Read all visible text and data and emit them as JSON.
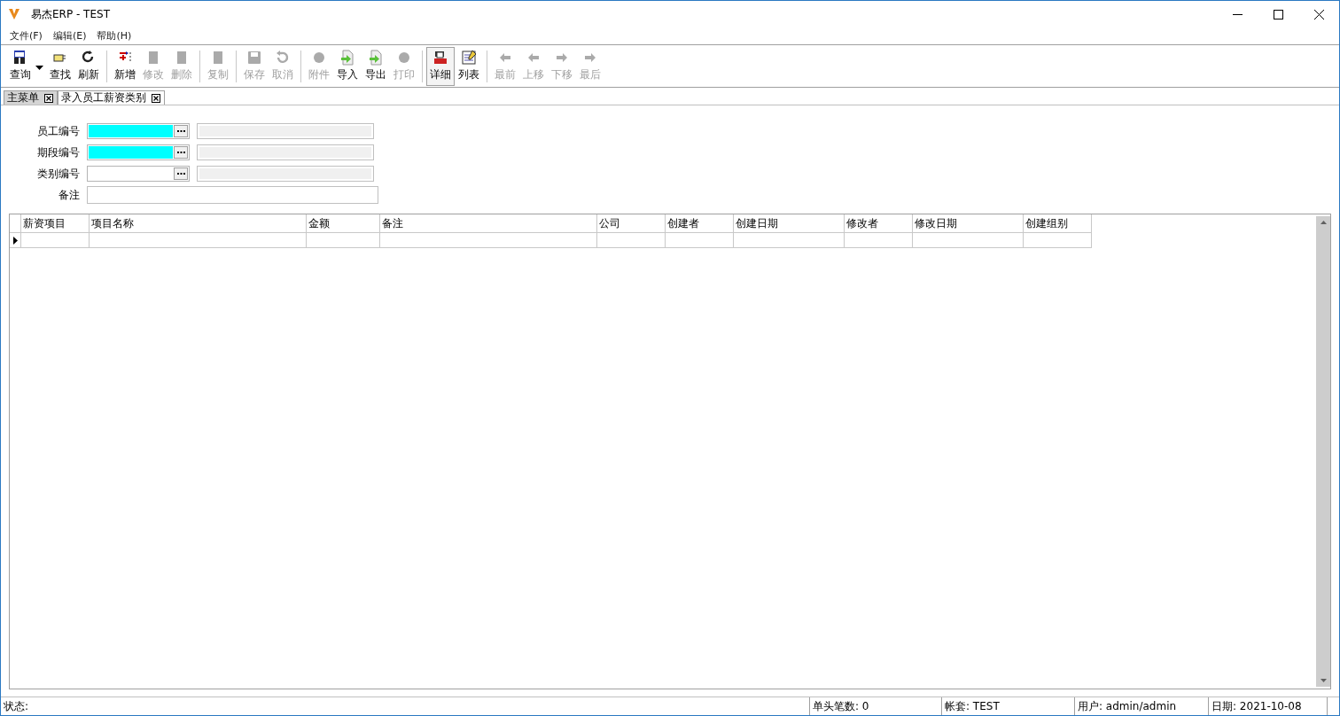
{
  "window": {
    "title": "易杰ERP - TEST"
  },
  "menu": [
    {
      "label": "文件(F)"
    },
    {
      "label": "编辑(E)"
    },
    {
      "label": "帮助(H)"
    }
  ],
  "toolbar": [
    {
      "items": [
        {
          "label": "查询",
          "disabled": false,
          "selected": false,
          "dropdown": true
        },
        {
          "label": "查找",
          "disabled": false,
          "selected": false,
          "dropdown": false
        },
        {
          "label": "刷新",
          "disabled": false,
          "selected": false,
          "dropdown": false
        }
      ]
    },
    {
      "items": [
        {
          "label": "新增",
          "disabled": false,
          "selected": false,
          "dropdown": false
        },
        {
          "label": "修改",
          "disabled": true,
          "selected": false,
          "dropdown": false
        },
        {
          "label": "删除",
          "disabled": true,
          "selected": false,
          "dropdown": false
        }
      ]
    },
    {
      "items": [
        {
          "label": "复制",
          "disabled": true,
          "selected": false,
          "dropdown": false
        }
      ]
    },
    {
      "items": [
        {
          "label": "保存",
          "disabled": true,
          "selected": false,
          "dropdown": false
        },
        {
          "label": "取消",
          "disabled": true,
          "selected": false,
          "dropdown": false
        }
      ]
    },
    {
      "items": [
        {
          "label": "附件",
          "disabled": true,
          "selected": false,
          "dropdown": false
        },
        {
          "label": "导入",
          "disabled": false,
          "selected": false,
          "dropdown": false
        },
        {
          "label": "导出",
          "disabled": false,
          "selected": false,
          "dropdown": false
        },
        {
          "label": "打印",
          "disabled": true,
          "selected": false,
          "dropdown": false
        }
      ]
    },
    {
      "items": [
        {
          "label": "详细",
          "disabled": false,
          "selected": true,
          "dropdown": false
        },
        {
          "label": "列表",
          "disabled": false,
          "selected": false,
          "dropdown": false
        }
      ]
    },
    {
      "items": [
        {
          "label": "最前",
          "disabled": true,
          "selected": false,
          "dropdown": false
        },
        {
          "label": "上移",
          "disabled": true,
          "selected": false,
          "dropdown": false
        },
        {
          "label": "下移",
          "disabled": true,
          "selected": false,
          "dropdown": false
        },
        {
          "label": "最后",
          "disabled": true,
          "selected": false,
          "dropdown": false
        }
      ]
    }
  ],
  "tabs": [
    {
      "label": "主菜单",
      "selected": false
    },
    {
      "label": "录入员工薪资类别",
      "selected": true
    }
  ],
  "form": [
    {
      "label": "员工编号",
      "kind": "lookup",
      "required": true
    },
    {
      "label": "期段编号",
      "kind": "lookup",
      "required": true
    },
    {
      "label": "类别编号",
      "kind": "lookup",
      "required": false
    },
    {
      "label": "备注",
      "kind": "text",
      "required": false
    }
  ],
  "table": {
    "columns": [
      "薪资项目",
      "项目名称",
      "金额",
      "备注",
      "公司",
      "创建者",
      "创建日期",
      "修改者",
      "修改日期",
      "创建组别"
    ],
    "rows": [
      {
        "current": true
      }
    ]
  },
  "status_bar": [
    "状态:",
    "单头笔数: 0",
    "帐套: TEST",
    "用户: admin/admin",
    "日期: 2021-10-08"
  ]
}
